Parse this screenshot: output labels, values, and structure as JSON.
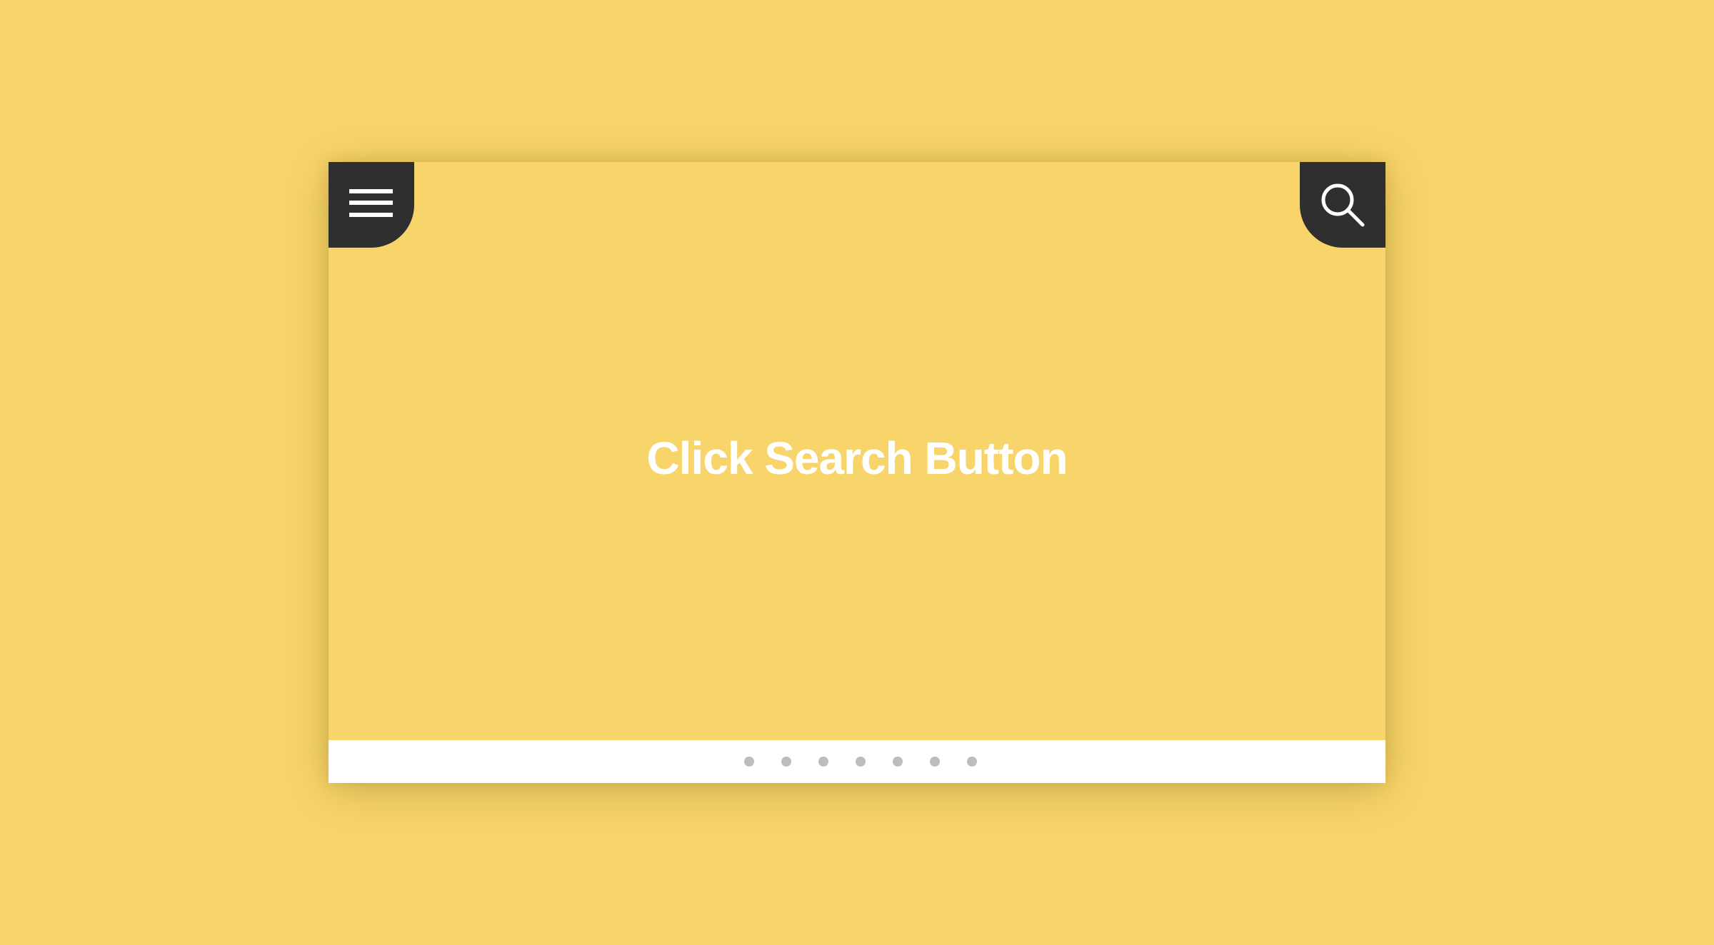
{
  "main": {
    "headline": "Click Search Button"
  },
  "controls": {
    "menu_icon": "hamburger-menu-icon",
    "search_icon": "magnifier-search-icon"
  },
  "pagination": {
    "count": 7,
    "dot_color": "#BDBDBD"
  },
  "colors": {
    "background": "#F8D56B",
    "corner_button": "#2F2F2F",
    "footer": "#FFFFFF",
    "text": "#FFFFFF"
  }
}
